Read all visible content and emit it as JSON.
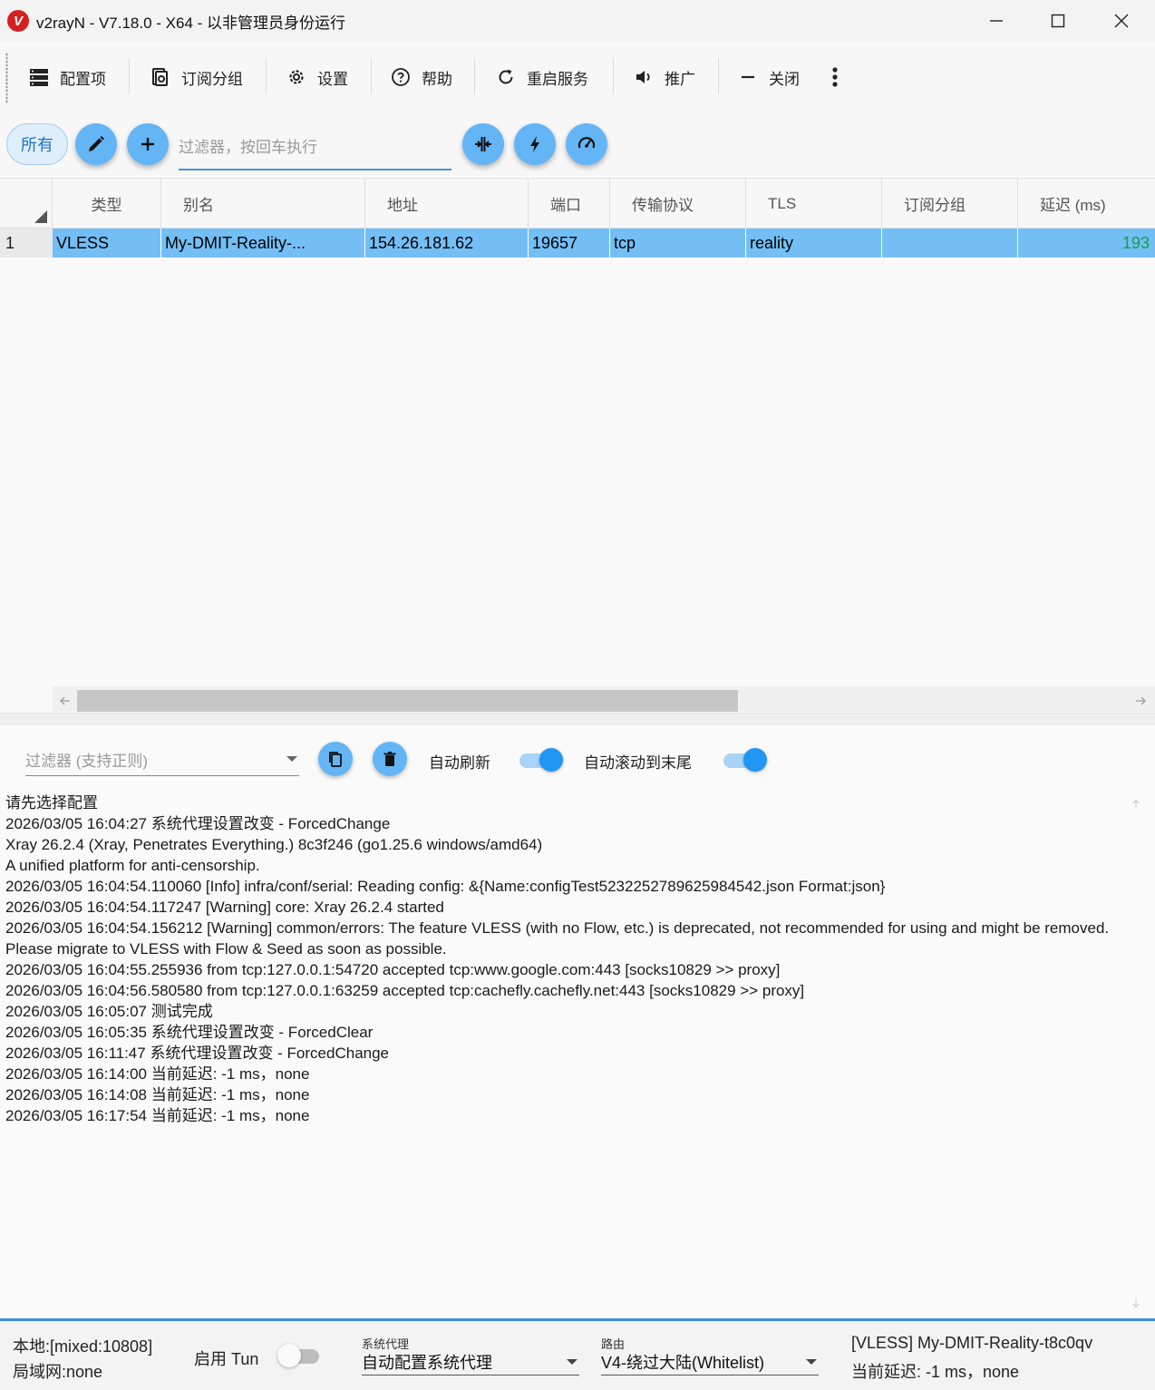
{
  "window": {
    "title": "v2rayN - V7.18.0 - X64 - 以非管理员身份运行",
    "logo_glyph": "V"
  },
  "toolbar": {
    "items": [
      {
        "label": "配置项",
        "icon": "server-list-icon"
      },
      {
        "label": "订阅分组",
        "icon": "subscription-icon"
      },
      {
        "label": "设置",
        "icon": "gear-icon"
      },
      {
        "label": "帮助",
        "icon": "help-icon"
      },
      {
        "label": "重启服务",
        "icon": "restart-icon"
      },
      {
        "label": "推广",
        "icon": "speaker-icon"
      },
      {
        "label": "关闭",
        "icon": "minus-icon"
      }
    ]
  },
  "filter_bar": {
    "all_chip": "所有",
    "filter_placeholder": "过滤器，按回车执行"
  },
  "grid": {
    "columns": [
      "类型",
      "别名",
      "地址",
      "端口",
      "传输协议",
      "TLS",
      "订阅分组",
      "延迟 (ms)"
    ],
    "rows": [
      {
        "num": "1",
        "type": "VLESS",
        "alias": "My-DMIT-Reality-...",
        "address": "154.26.181.62",
        "port": "19657",
        "transport": "tcp",
        "tls": "reality",
        "subscription": "",
        "delay": "193"
      }
    ]
  },
  "log_panel": {
    "filter_placeholder": "过滤器 (支持正则)",
    "auto_refresh_label": "自动刷新",
    "auto_scroll_label": "自动滚动到末尾",
    "auto_refresh_on": true,
    "auto_scroll_on": true,
    "lines": [
      "请先选择配置",
      "2026/03/05 16:04:27 系统代理设置改变 - ForcedChange",
      "Xray 26.2.4 (Xray, Penetrates Everything.) 8c3f246 (go1.25.6 windows/amd64)",
      "A unified platform for anti-censorship.",
      "2026/03/05 16:04:54.110060 [Info] infra/conf/serial: Reading config: &{Name:configTest5232252789625984542.json Format:json}",
      "2026/03/05 16:04:54.117247 [Warning] core: Xray 26.2.4 started",
      "2026/03/05 16:04:54.156212 [Warning] common/errors: The feature VLESS (with no Flow, etc.) is deprecated, not recommended for using and might be removed. Please migrate to VLESS with Flow & Seed as soon as possible.",
      "2026/03/05 16:04:55.255936 from tcp:127.0.0.1:54720 accepted tcp:www.google.com:443 [socks10829 >> proxy]",
      "2026/03/05 16:04:56.580580 from tcp:127.0.0.1:63259 accepted tcp:cachefly.cachefly.net:443 [socks10829 >> proxy]",
      "2026/03/05 16:05:07 测试完成",
      "2026/03/05 16:05:35 系统代理设置改变 - ForcedClear",
      "2026/03/05 16:11:47 系统代理设置改变 - ForcedChange",
      "2026/03/05 16:14:00 当前延迟: -1 ms，none",
      "2026/03/05 16:14:08 当前延迟: -1 ms，none",
      "2026/03/05 16:17:54 当前延迟: -1 ms，none"
    ]
  },
  "statusbar": {
    "local": "本地:[mixed:10808]",
    "lan": "局域网:none",
    "tun_label": "启用 Tun",
    "tun_on": false,
    "sysproxy_caption": "系统代理",
    "sysproxy_value": "自动配置系统代理",
    "routing_caption": "路由",
    "routing_value": "V4-绕过大陆(Whitelist)",
    "current_server": "[VLESS] My-DMIT-Reality-t8c0qv",
    "current_delay": "当前延迟: -1 ms，none"
  },
  "colors": {
    "accent": "#64b5f6",
    "selected_row": "#73bff5",
    "delay_good": "#14a04a",
    "logo_red": "#d42020"
  }
}
